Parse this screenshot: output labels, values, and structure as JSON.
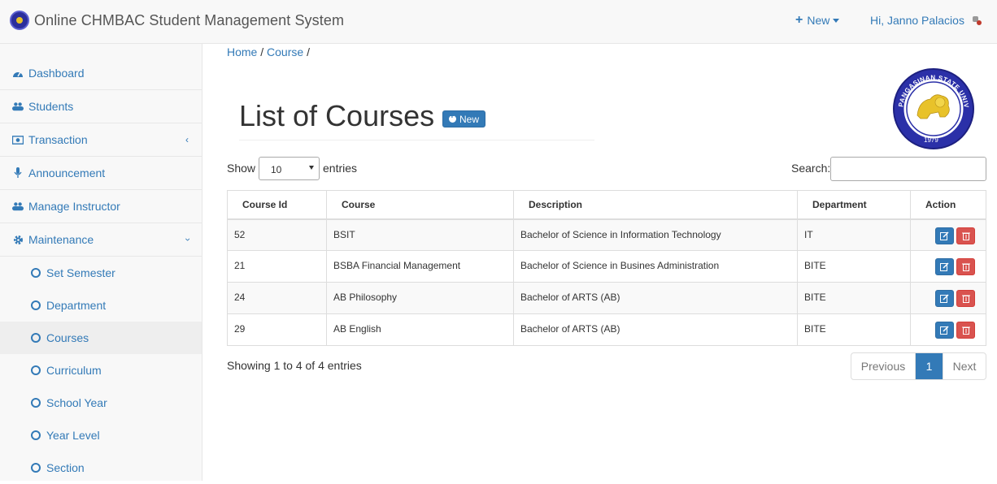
{
  "header": {
    "title": "Online CHMBAC Student Management System",
    "new_label": "New",
    "user_label": "Hi, Janno Palacios"
  },
  "sidebar": {
    "items": [
      {
        "label": "Dashboard",
        "icon": "dashboard-icon"
      },
      {
        "label": "Students",
        "icon": "users-icon"
      },
      {
        "label": "Transaction",
        "icon": "money-icon"
      },
      {
        "label": "Announcement",
        "icon": "microphone-icon"
      },
      {
        "label": "Manage Instructor",
        "icon": "users-icon"
      },
      {
        "label": "Maintenance",
        "icon": "gear-icon"
      }
    ],
    "subitems": [
      "Set Semester",
      "Department",
      "Courses",
      "Curriculum",
      "School Year",
      "Year Level",
      "Section"
    ],
    "active_subitem": "Courses"
  },
  "breadcrumb": {
    "home": "Home",
    "course": "Course",
    "sep": "/"
  },
  "page": {
    "title": "List of Courses",
    "new_button": "New",
    "seal_text": "PANGASINAN STATE UNIVERSITY",
    "seal_year": "1979"
  },
  "table_controls": {
    "show_label": "Show",
    "page_size": "10",
    "entries_label": "entries",
    "search_label": "Search:"
  },
  "table": {
    "columns": [
      "Course Id",
      "Course",
      "Description",
      "Department",
      "Action"
    ],
    "rows": [
      {
        "id": "52",
        "course": "BSIT",
        "description": "Bachelor of Science in Information Technology",
        "department": "IT"
      },
      {
        "id": "21",
        "course": "BSBA Financial Management",
        "description": "Bachelor of Science in Busines Administration",
        "department": "BITE"
      },
      {
        "id": "24",
        "course": "AB Philosophy",
        "description": "Bachelor of ARTS (AB)",
        "department": "BITE"
      },
      {
        "id": "29",
        "course": "AB English",
        "description": "Bachelor of ARTS (AB)",
        "department": "BITE"
      }
    ]
  },
  "footer": {
    "info": "Showing 1 to 4 of 4 entries",
    "prev": "Previous",
    "page": "1",
    "next": "Next"
  },
  "colors": {
    "accent": "#337ab7",
    "danger": "#d9534f"
  }
}
